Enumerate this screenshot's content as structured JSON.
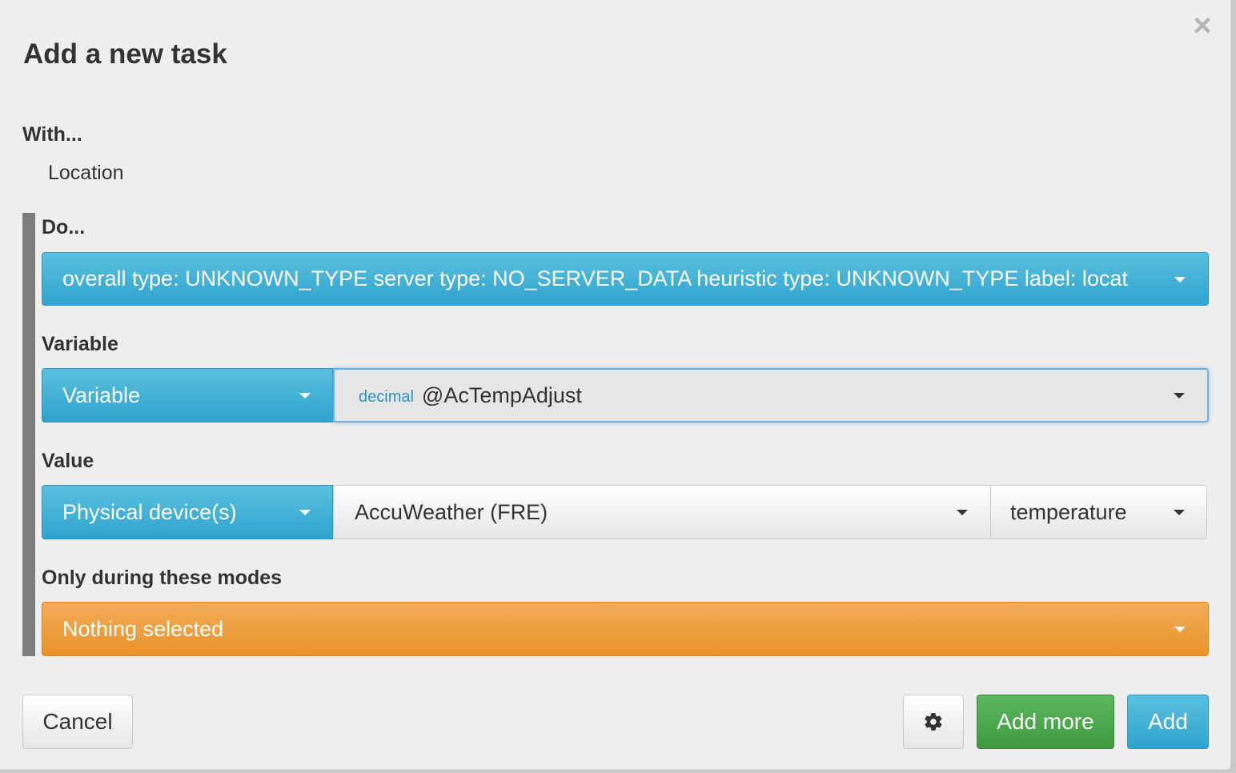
{
  "dialog": {
    "title": "Add a new task",
    "close_glyph": "×"
  },
  "with": {
    "label": "With...",
    "value": "Location"
  },
  "do": {
    "label": "Do...",
    "selected": "overall type: UNKNOWN_TYPE server type: NO_SERVER_DATA heuristic type: UNKNOWN_TYPE label: locat"
  },
  "variable": {
    "label": "Variable",
    "type_selected": "Variable",
    "value_type_tag": "decimal",
    "value_selected": "@AcTempAdjust"
  },
  "value": {
    "label": "Value",
    "type_selected": "Physical device(s)",
    "device_selected": "AccuWeather (FRE)",
    "attribute_selected": "temperature"
  },
  "modes": {
    "label": "Only during these modes",
    "selected": "Nothing selected"
  },
  "footer": {
    "cancel_label": "Cancel",
    "settings_icon": "gear-icon",
    "add_more_label": "Add more",
    "add_label": "Add"
  },
  "colors": {
    "primary_blue": "#3aacd6",
    "warning_orange": "#ec9a33",
    "success_green": "#4cae4c",
    "focus_outline": "#66afe9"
  }
}
